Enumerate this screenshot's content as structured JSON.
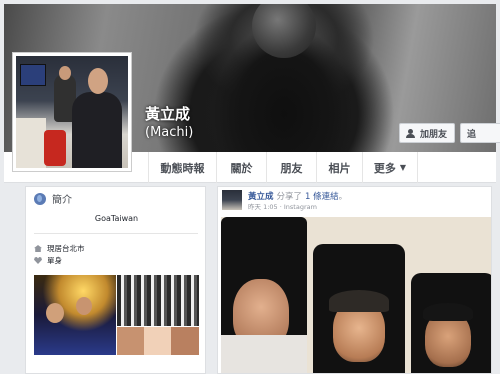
{
  "profile": {
    "name": "黃立成",
    "alias": "(Machi)"
  },
  "cover_buttons": {
    "add_friend": "加朋友",
    "follow": "追"
  },
  "tabs": [
    {
      "label": "動態時報"
    },
    {
      "label": "關於"
    },
    {
      "label": "朋友"
    },
    {
      "label": "相片"
    },
    {
      "label": "更多"
    }
  ],
  "intro": {
    "title": "簡介",
    "bio": "GoaTaiwan",
    "city": "現居台北市",
    "relationship": "單身"
  },
  "post": {
    "author": "黃立成",
    "action": "分享了",
    "link": "1 條連結",
    "dot": "。",
    "time": "昨天 1:05",
    "separator": " · ",
    "source": "Instagram"
  },
  "icons": {
    "intro": "globe-icon",
    "city": "home-icon",
    "relationship": "heart-icon",
    "add_friend": "add-friend-icon",
    "more_caret": "caret-down-icon"
  },
  "colors": {
    "link_blue": "#365899",
    "meta_gray": "#90949c",
    "page_bg": "#e9ebee"
  }
}
